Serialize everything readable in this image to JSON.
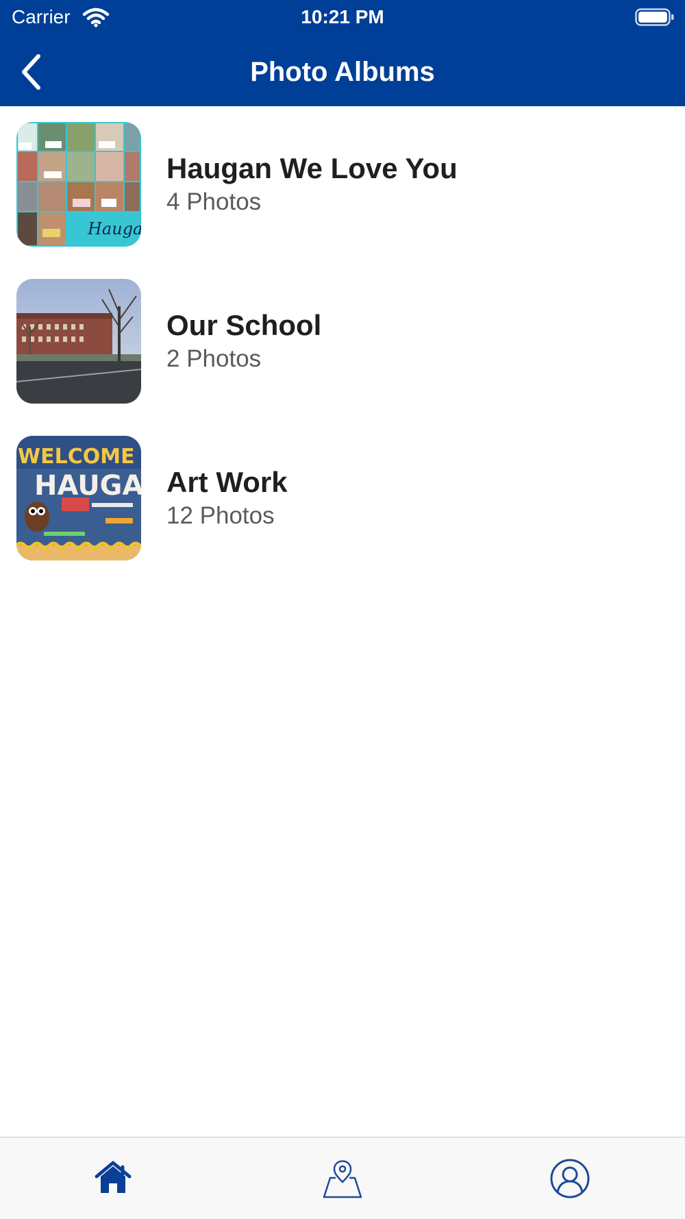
{
  "status_bar": {
    "carrier": "Carrier",
    "time": "10:21 PM"
  },
  "nav": {
    "title": "Photo Albums",
    "back_icon": "chevron-left-icon"
  },
  "albums": [
    {
      "title": "Haugan We Love You",
      "count": "4 Photos",
      "thumb_text": "Haugan"
    },
    {
      "title": "Our School",
      "count": "2 Photos"
    },
    {
      "title": "Art Work",
      "count": "12 Photos",
      "thumb_text": "WELCOME T HAUGA"
    }
  ],
  "tabs": [
    {
      "icon": "home-icon",
      "active": true
    },
    {
      "icon": "map-pin-icon",
      "active": false
    },
    {
      "icon": "user-circle-icon",
      "active": false
    }
  ],
  "colors": {
    "primary": "#003f98",
    "tab_active": "#0a3f96",
    "tab_inactive": "#1b4a9a"
  }
}
